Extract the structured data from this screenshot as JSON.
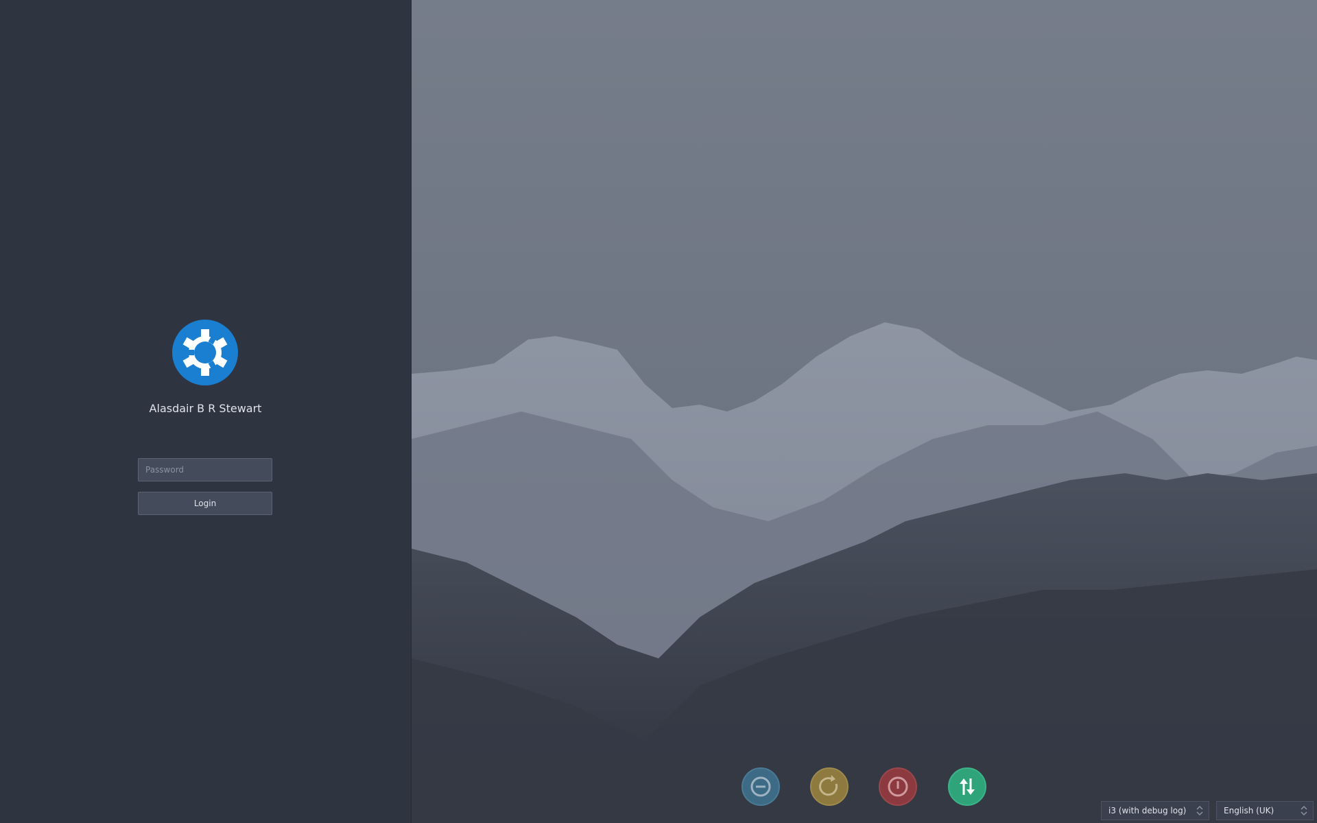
{
  "login": {
    "user_name": "Alasdair B R Stewart",
    "password_placeholder": "Password",
    "login_label": "Login",
    "logo_icon": "kubuntu-logo-icon"
  },
  "power_buttons": [
    {
      "name": "suspend",
      "icon": "minus-circle-icon",
      "color": "#3d6b86"
    },
    {
      "name": "reboot",
      "icon": "refresh-icon",
      "color": "#8e7a3f"
    },
    {
      "name": "shutdown",
      "icon": "power-icon",
      "color": "#8c3a40"
    },
    {
      "name": "switch-user",
      "icon": "arrows-up-down-icon",
      "color": "#2fa47a"
    }
  ],
  "session": {
    "selected": "i3 (with debug log)"
  },
  "keyboard_layout": {
    "selected": "English (UK)"
  },
  "colors": {
    "panel_background": "#2f3441",
    "accent_logo": "#1a7fd1",
    "text": "#dfe3ea"
  }
}
